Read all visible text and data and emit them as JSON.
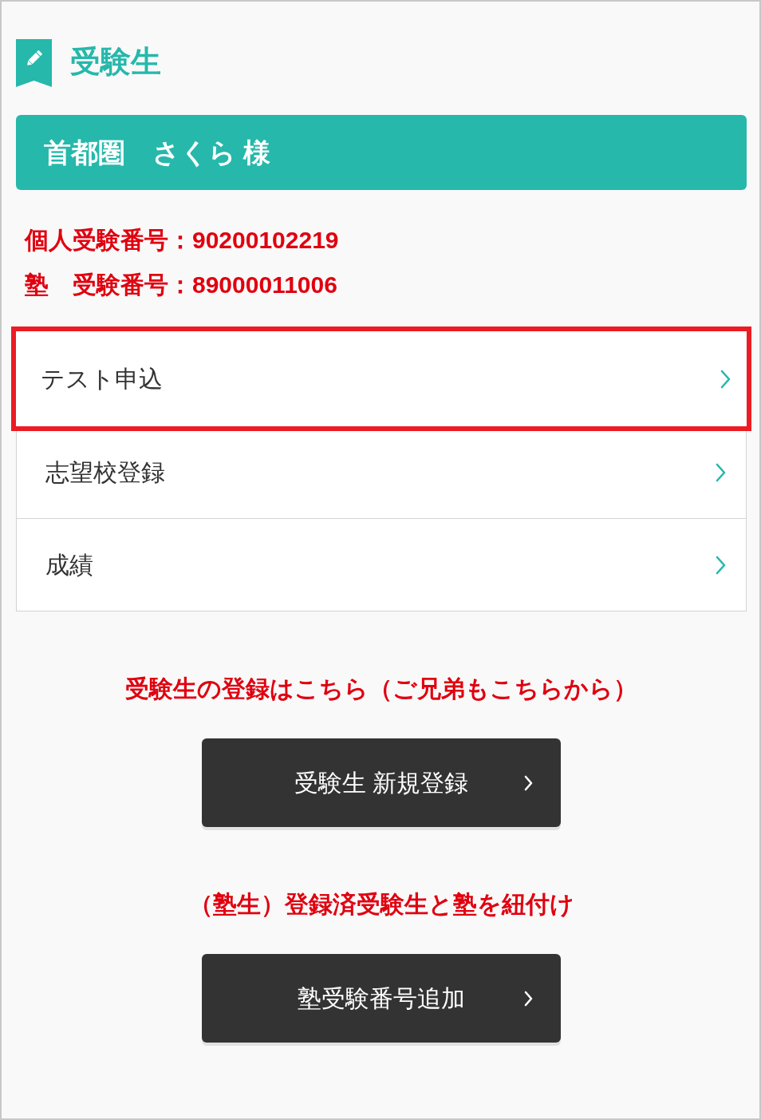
{
  "header": {
    "title": "受験生"
  },
  "banner": {
    "text": "首都圏　さくら 様"
  },
  "ids": [
    {
      "text": "個人受験番号：90200102219"
    },
    {
      "text": "塾　受験番号：89000011006"
    }
  ],
  "menu": [
    {
      "label": "テスト申込",
      "highlighted": true
    },
    {
      "label": "志望校登録",
      "highlighted": false
    },
    {
      "label": "成績",
      "highlighted": false
    }
  ],
  "actions": [
    {
      "note": "受験生の登録はこちら（ご兄弟もこちらから）",
      "button": "受験生 新規登録"
    },
    {
      "note": "（塾生）登録済受験生と塾を紐付け",
      "button": "塾受験番号追加"
    }
  ]
}
